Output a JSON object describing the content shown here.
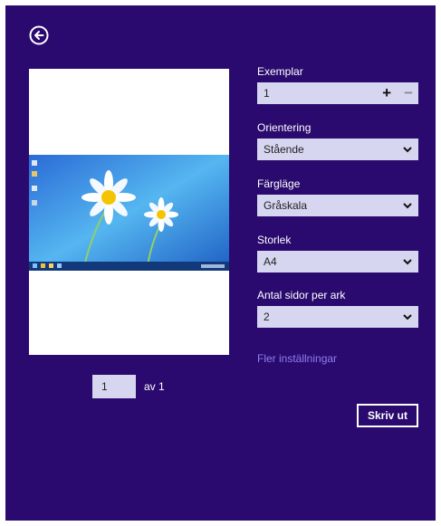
{
  "colors": {
    "background": "#2a0a6e",
    "field": "#d6d6f0",
    "link": "#8f7ff0"
  },
  "header": {
    "back_icon": "back-arrow-icon"
  },
  "preview": {
    "page_number": "1",
    "page_total": "av 1",
    "image_description_icon": "desktop-screenshot-icon"
  },
  "settings": {
    "copies": {
      "label": "Exemplar",
      "value": "1",
      "increment": "+",
      "decrement": "−"
    },
    "orientation": {
      "label": "Orientering",
      "value": "Stående"
    },
    "color_mode": {
      "label": "Färgläge",
      "value": "Gråskala"
    },
    "size": {
      "label": "Storlek",
      "value": "A4"
    },
    "pages_per_sheet": {
      "label": "Antal sidor per ark",
      "value": "2"
    },
    "more_link": "Fler inställningar",
    "print_button": "Skriv ut"
  }
}
